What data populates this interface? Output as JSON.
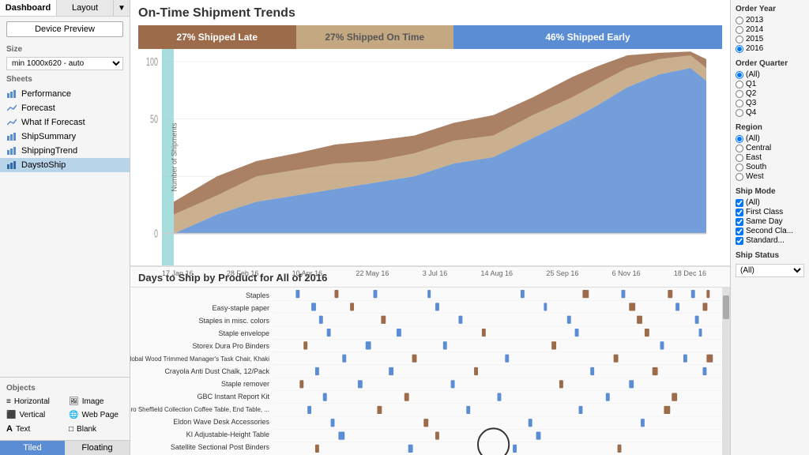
{
  "sidebar": {
    "tabs": [
      "Dashboard",
      "Layout"
    ],
    "active_tab": "Dashboard",
    "device_preview": "Device Preview",
    "size_label": "Size",
    "size_value": "min 1000x620 - auto",
    "sheets_label": "Sheets",
    "sheets": [
      {
        "label": "Performance",
        "icon": "bar",
        "active": false
      },
      {
        "label": "Forecast",
        "icon": "line",
        "active": false
      },
      {
        "label": "What If Forecast",
        "icon": "line",
        "active": false
      },
      {
        "label": "ShipSummary",
        "icon": "bar",
        "active": false
      },
      {
        "label": "ShippingTrend",
        "icon": "bar",
        "active": false
      },
      {
        "label": "DaystoShip",
        "icon": "bar",
        "active": true
      }
    ],
    "objects_label": "Objects",
    "objects": [
      {
        "label": "Horizontal",
        "icon": "≡"
      },
      {
        "label": "Image",
        "icon": "🖼"
      },
      {
        "label": "Vertical",
        "icon": "|||"
      },
      {
        "label": "Web Page",
        "icon": "🌐"
      },
      {
        "label": "Text",
        "icon": "A"
      },
      {
        "label": "Blank",
        "icon": "□"
      }
    ],
    "tiled_label": "Tiled",
    "floating_label": "Floating"
  },
  "main": {
    "chart_title": "On-Time Shipment Trends",
    "stacked_bar": {
      "late_pct": "27% Shipped Late",
      "late_width": "27",
      "ontime_pct": "27% Shipped On Time",
      "ontime_width": "27",
      "early_pct": "46% Shipped Early",
      "early_width": "46"
    },
    "x_axis_labels": [
      "17 Jan 16",
      "28 Feb 16",
      "10 Apr 16",
      "22 May 16",
      "3 Jul 16",
      "14 Aug 16",
      "25 Sep 16",
      "6 Nov 16",
      "18 Dec 16"
    ],
    "y_axis_label": "Number of Shipments",
    "y_axis_ticks": [
      "0",
      "50",
      "100"
    ],
    "bottom_title": "Days to Ship by Product for All of 2016",
    "products": [
      "Staples",
      "Easy-staple paper",
      "Staples in misc. colors",
      "Staple envelope",
      "Storex Dura Pro Binders",
      "Global Wood Trimmed Manager's Task Chair, Khaki",
      "Crayola Anti Dust Chalk, 12/Pack",
      "Staple remover",
      "GBC Instant Report Kit",
      "Lesro Sheffield Collection Coffee Table, End Table, ...",
      "Eldon Wave Desk Accessories",
      "KI Adjustable-Height Table",
      "Satellite Sectional Post Binders"
    ]
  },
  "right_panel": {
    "order_year_label": "Order Year",
    "years": [
      "2013",
      "2014",
      "2015",
      "2016"
    ],
    "selected_year": "2016",
    "order_quarter_label": "Order Quarter",
    "quarters": [
      "(All)",
      "Q1",
      "Q2",
      "Q3",
      "Q4"
    ],
    "selected_quarter": "(All)",
    "region_label": "Region",
    "regions": [
      "(All)",
      "Central",
      "East",
      "South",
      "West"
    ],
    "selected_region": "(All)",
    "ship_mode_label": "Ship Mode",
    "ship_modes": [
      "(All)",
      "First Class",
      "Same Day",
      "Second Cla...",
      "Standard..."
    ],
    "ship_status_label": "Ship Status",
    "ship_status_options": [
      "(All)"
    ],
    "selected_ship_status": "(All)"
  }
}
